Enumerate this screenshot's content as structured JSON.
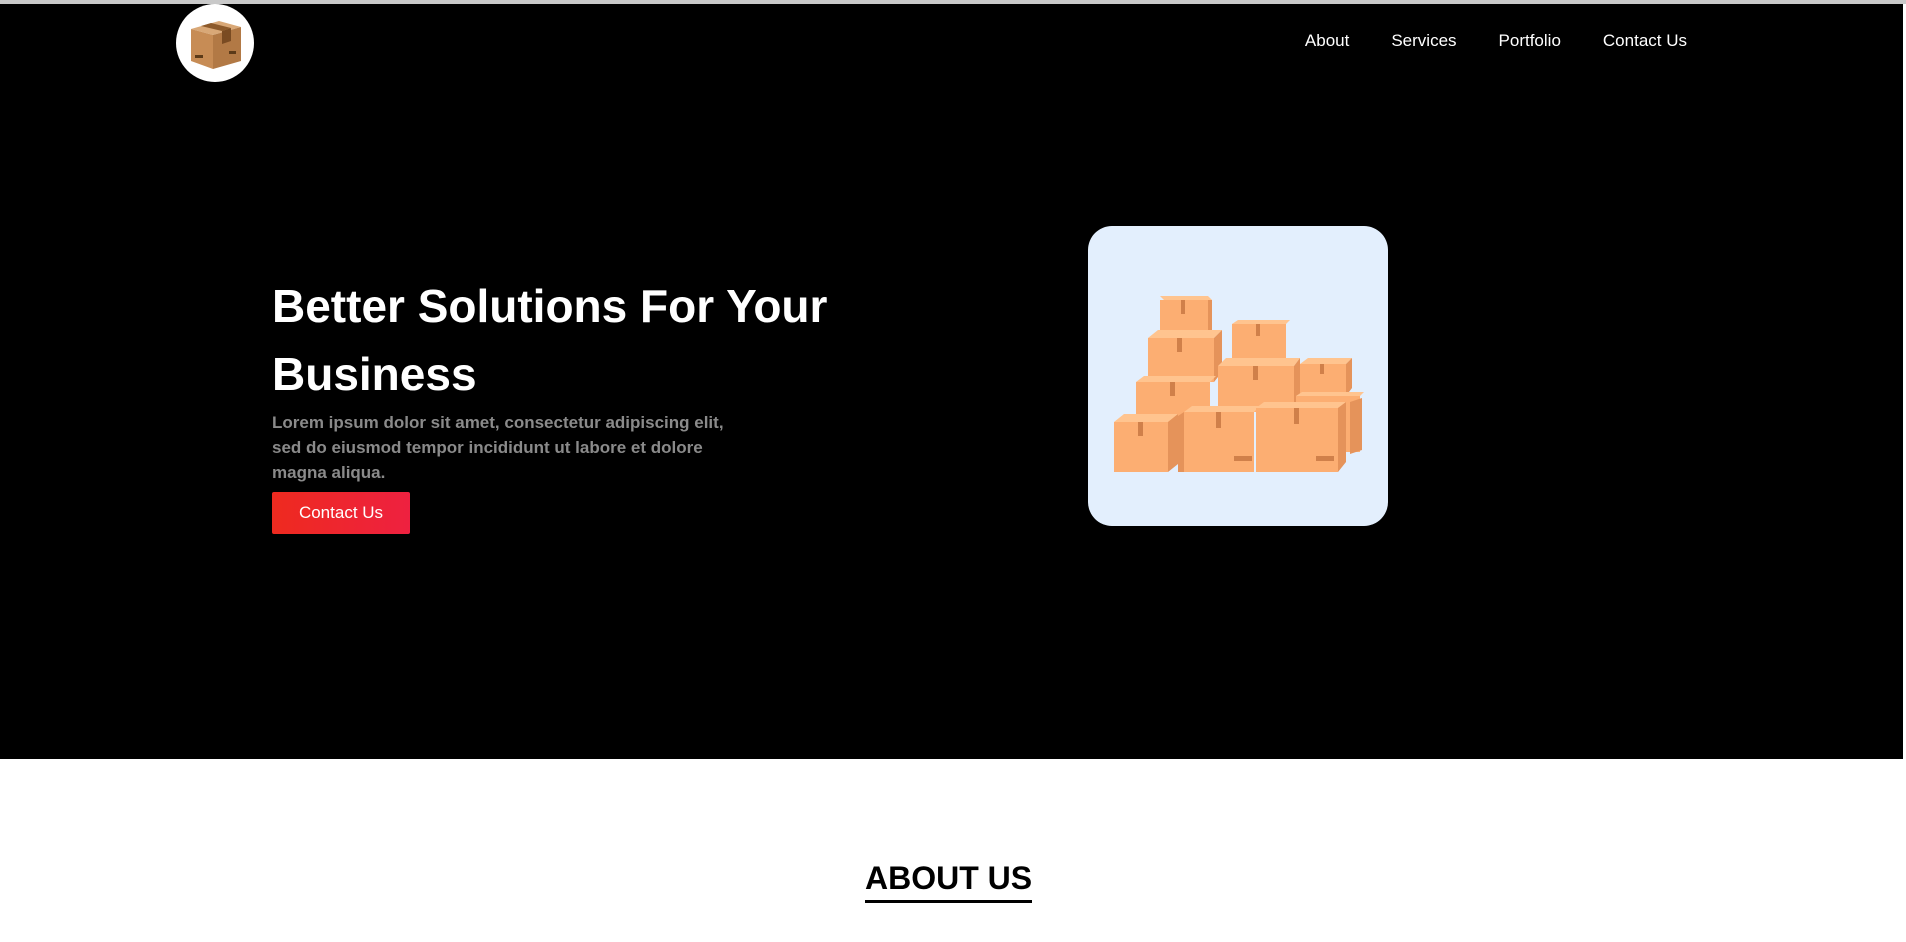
{
  "header": {
    "logo_icon": "cardboard-box-icon",
    "nav": [
      {
        "label": "About"
      },
      {
        "label": "Services"
      },
      {
        "label": "Portfolio"
      },
      {
        "label": "Contact Us"
      }
    ]
  },
  "hero": {
    "headline_line1": "Better Solutions For Your",
    "headline_line2": "Business",
    "description": "Lorem ipsum dolor sit amet, consectetur adipiscing elit, sed do eiusmod tempor incididunt ut labore et dolore magna aliqua.",
    "cta_label": "Contact Us",
    "illustration_icon": "stacked-boxes-illustration",
    "colors": {
      "background": "#000000",
      "cta": "#ee2a1f",
      "illustration_bg": "#e3effd"
    }
  },
  "about": {
    "title": "ABOUT US"
  }
}
